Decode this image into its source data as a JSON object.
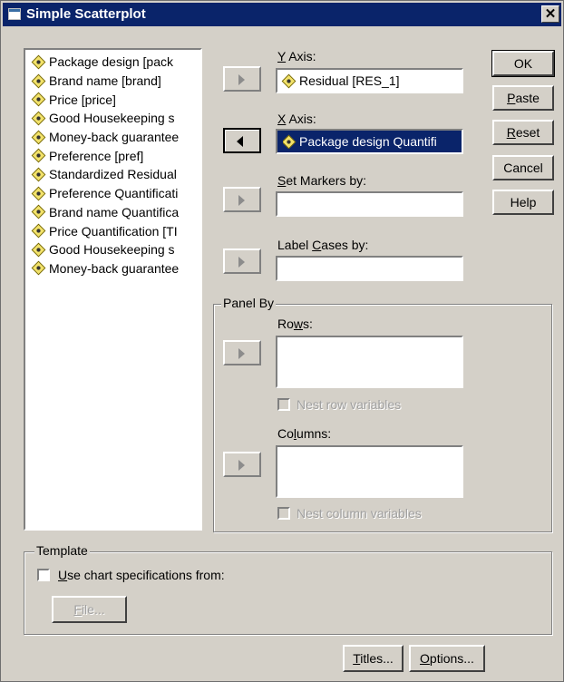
{
  "window": {
    "title": "Simple Scatterplot",
    "close_glyph": "✕"
  },
  "variables": [
    "Package design [pack",
    "Brand name [brand]",
    "Price [price]",
    "Good Housekeeping s",
    "Money-back guarantee",
    "Preference [pref]",
    "Standardized Residual",
    "Preference Quantificati",
    "Brand name Quantifica",
    "Price Quantification [TI",
    "Good Housekeeping s",
    "Money-back guarantee"
  ],
  "y_axis": {
    "label_u": "Y",
    "label_rest": " Axis:",
    "value": "Residual [RES_1]"
  },
  "x_axis": {
    "label_u": "X",
    "label_rest": " Axis:",
    "value": "Package design Quantifi"
  },
  "markers": {
    "label_u": "S",
    "label_rest": "et Markers by:",
    "value": ""
  },
  "label_cases": {
    "label_pre": "Label ",
    "label_u": "C",
    "label_rest": "ases by:",
    "value": ""
  },
  "panel_by": {
    "title": "Panel By",
    "rows_pre": "Ro",
    "rows_u": "w",
    "rows_rest": "s:",
    "nest_rows": "Nest row variables",
    "cols_pre": "Co",
    "cols_u": "l",
    "cols_rest": "umns:",
    "nest_cols": "Nest column variables"
  },
  "buttons": {
    "ok": "OK",
    "paste_u": "P",
    "paste_rest": "aste",
    "reset_u": "R",
    "reset_rest": "eset",
    "cancel": "Cancel",
    "help": "Help"
  },
  "template": {
    "title": "Template",
    "use_u": "U",
    "use_rest": "se chart specifications from:",
    "file_u": "F",
    "file_rest": "ile..."
  },
  "bottom": {
    "titles_u": "T",
    "titles_rest": "itles...",
    "options_u": "O",
    "options_rest": "ptions..."
  }
}
